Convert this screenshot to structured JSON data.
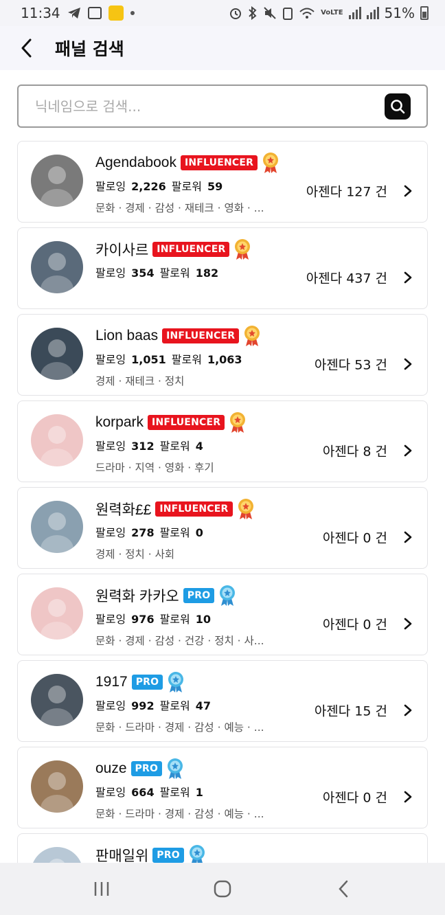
{
  "status_bar": {
    "time": "11:34",
    "battery": "51%"
  },
  "header": {
    "title": "패널 검색"
  },
  "search": {
    "placeholder": "닉네임으로 검색..."
  },
  "colors": {
    "influencer_badge": "#e8141e",
    "pro_badge": "#1e9ce4"
  },
  "panels": [
    {
      "name": "Agendabook",
      "badge": "INFLUENCER",
      "badge_type": "influencer",
      "following_label": "팔로잉",
      "following": "2,226",
      "follower_label": "팔로워",
      "followers": "59",
      "categories": "문화 · 경제 · 감성 · 재테크 · 영화 · ...",
      "agenda": "아젠다 127 건",
      "medal": "gold-medal-icon"
    },
    {
      "name": "카이사르",
      "badge": "INFLUENCER",
      "badge_type": "influencer",
      "following_label": "팔로잉",
      "following": "354",
      "follower_label": "팔로워",
      "followers": "182",
      "categories": "",
      "agenda": "아젠다 437 건",
      "medal": "gold-medal-icon"
    },
    {
      "name": "Lion baas",
      "badge": "INFLUENCER",
      "badge_type": "influencer",
      "following_label": "팔로잉",
      "following": "1,051",
      "follower_label": "팔로워",
      "followers": "1,063",
      "categories": "경제 · 재테크 · 정치",
      "agenda": "아젠다 53 건",
      "medal": "gold-medal-icon"
    },
    {
      "name": "korpark",
      "badge": "INFLUENCER",
      "badge_type": "influencer",
      "following_label": "팔로잉",
      "following": "312",
      "follower_label": "팔로워",
      "followers": "4",
      "categories": "드라마 · 지역 · 영화 · 후기",
      "agenda": "아젠다 8 건",
      "medal": "gold-medal-icon"
    },
    {
      "name": "원력화££",
      "badge": "INFLUENCER",
      "badge_type": "influencer",
      "following_label": "팔로잉",
      "following": "278",
      "follower_label": "팔로워",
      "followers": "0",
      "categories": "경제 · 정치 · 사회",
      "agenda": "아젠다 0 건",
      "medal": "gold-medal-icon"
    },
    {
      "name": "원력화 카카오",
      "badge": "PRO",
      "badge_type": "pro",
      "following_label": "팔로잉",
      "following": "976",
      "follower_label": "팔로워",
      "followers": "10",
      "categories": "문화 · 경제 · 감성 · 건강 · 정치 · 사...",
      "agenda": "아젠다 0 건",
      "medal": "blue-medal-icon"
    },
    {
      "name": "1917",
      "badge": "PRO",
      "badge_type": "pro",
      "following_label": "팔로잉",
      "following": "992",
      "follower_label": "팔로워",
      "followers": "47",
      "categories": "문화 · 드라마 · 경제 · 감성 · 예능 · ...",
      "agenda": "아젠다 15 건",
      "medal": "blue-medal-icon"
    },
    {
      "name": "ouze",
      "badge": "PRO",
      "badge_type": "pro",
      "following_label": "팔로잉",
      "following": "664",
      "follower_label": "팔로워",
      "followers": "1",
      "categories": "문화 · 드라마 · 경제 · 감성 · 예능 · ...",
      "agenda": "아젠다 0 건",
      "medal": "blue-medal-icon"
    },
    {
      "name": "판매일위",
      "badge": "PRO",
      "badge_type": "pro",
      "following_label": "",
      "following": "",
      "follower_label": "",
      "followers": "",
      "categories": "",
      "agenda": "",
      "medal": "blue-medal-icon"
    }
  ]
}
